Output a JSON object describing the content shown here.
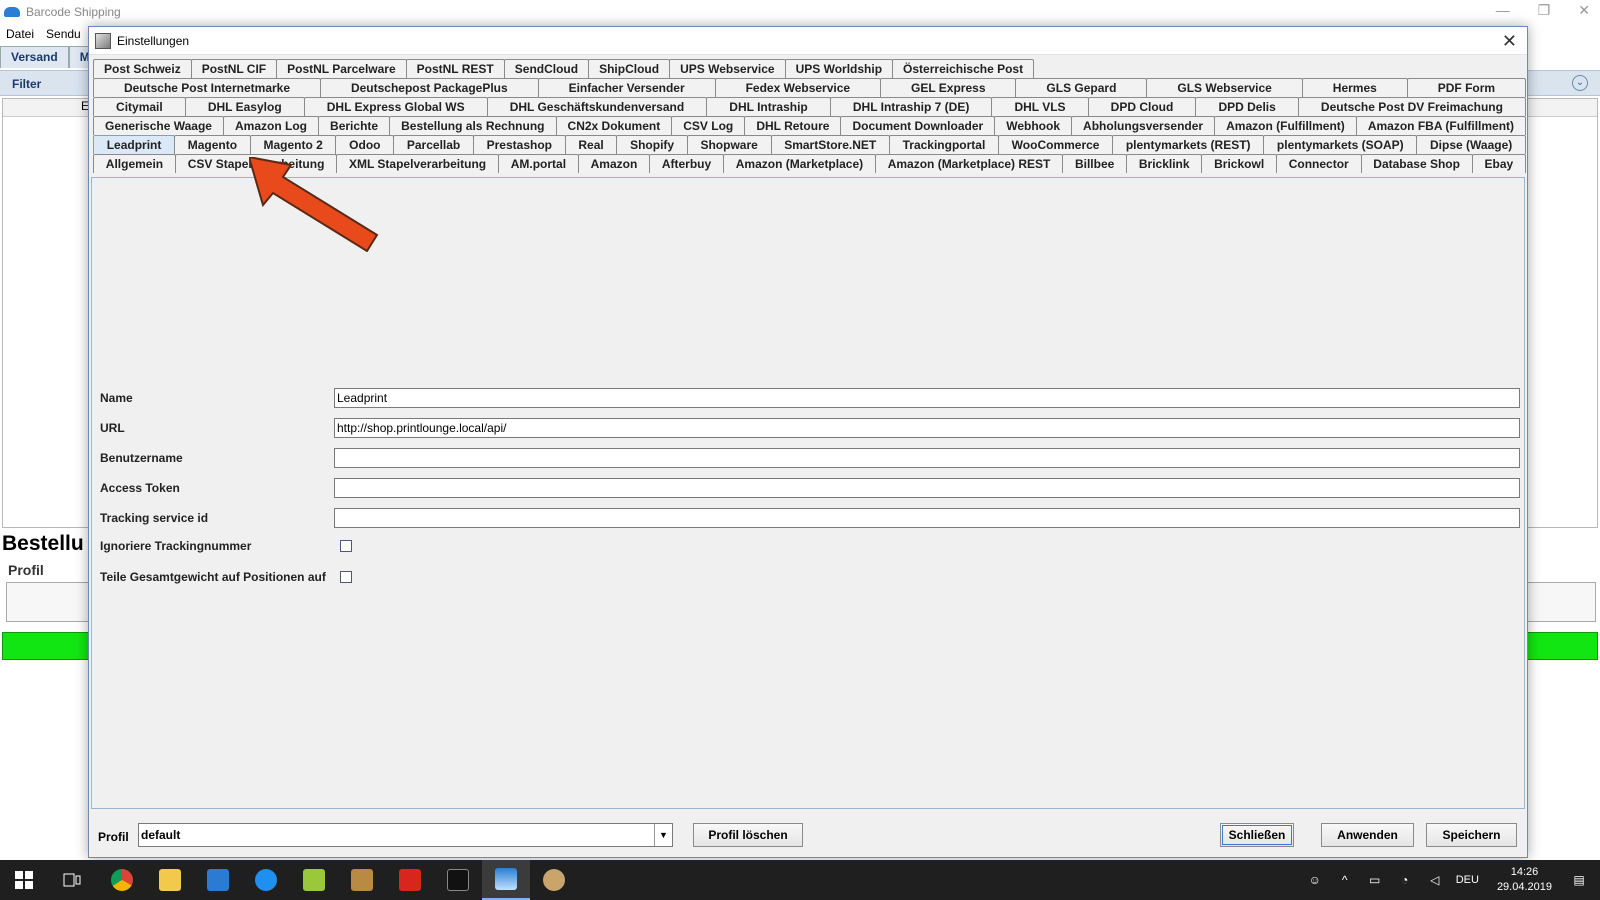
{
  "bg": {
    "window_title": "Barcode Shipping",
    "menu": [
      "Datei",
      "Sendu"
    ],
    "tabs": [
      "Versand",
      "M"
    ],
    "filter_label": "Filter",
    "grid_header_fragment": "E",
    "bestell_label": "Bestellu",
    "profil_label": "Profil"
  },
  "dialog": {
    "title": "Einstellungen",
    "tab_rows": [
      [
        "Post Schweiz",
        "PostNL CIF",
        "PostNL Parcelware",
        "PostNL REST",
        "SendCloud",
        "ShipCloud",
        "UPS Webservice",
        "UPS Worldship",
        "Österreichische Post"
      ],
      [
        "Deutsche Post Internetmarke",
        "Deutschepost PackagePlus",
        "Einfacher Versender",
        "Fedex Webservice",
        "GEL Express",
        "GLS Gepard",
        "GLS Webservice",
        "Hermes",
        "PDF Form"
      ],
      [
        "Citymail",
        "DHL Easylog",
        "DHL Express Global WS",
        "DHL Geschäftskundenversand",
        "DHL Intraship",
        "DHL Intraship 7 (DE)",
        "DHL VLS",
        "DPD Cloud",
        "DPD Delis",
        "Deutsche Post DV Freimachung"
      ],
      [
        "Generische Waage",
        "Amazon Log",
        "Berichte",
        "Bestellung als Rechnung",
        "CN2x Dokument",
        "CSV Log",
        "DHL Retoure",
        "Document Downloader",
        "Webhook",
        "Abholungsversender",
        "Amazon (Fulfillment)",
        "Amazon FBA (Fulfillment)"
      ],
      [
        "Leadprint",
        "Magento",
        "Magento 2",
        "Odoo",
        "Parcellab",
        "Prestashop",
        "Real",
        "Shopify",
        "Shopware",
        "SmartStore.NET",
        "Trackingportal",
        "WooCommerce",
        "plentymarkets (REST)",
        "plentymarkets (SOAP)",
        "Dipse (Waage)"
      ],
      [
        "Allgemein",
        "CSV Stapelverarbeitung",
        "XML Stapelverarbeitung",
        "AM.portal",
        "Amazon",
        "Afterbuy",
        "Amazon (Marketplace)",
        "Amazon (Marketplace) REST",
        "Billbee",
        "Bricklink",
        "Brickowl",
        "Connector",
        "Database Shop",
        "Ebay"
      ]
    ],
    "active_tab": "Leadprint",
    "form": {
      "name_label": "Name",
      "name_value": "Leadprint",
      "url_label": "URL",
      "url_value": "http://shop.printlounge.local/api/",
      "user_label": "Benutzername",
      "user_value": "",
      "token_label": "Access Token",
      "token_value": "",
      "tracking_label": "Tracking service id",
      "tracking_value": "",
      "ignore_label": "Ignoriere Trackingnummer",
      "ignore_checked": false,
      "split_label": "Teile Gesamtgewicht auf Positionen auf",
      "split_checked": false
    },
    "bottom": {
      "profil_label": "Profil",
      "profil_value": "default",
      "delete_label": "Profil löschen",
      "close_label": "Schließen",
      "apply_label": "Anwenden",
      "save_label": "Speichern"
    }
  },
  "taskbar": {
    "apps": [
      "windows-start",
      "task-view",
      "chrome",
      "file-explorer",
      "vscode",
      "teamviewer",
      "notepad-plus",
      "package",
      "acrobat",
      "terminal",
      "barcode-shipping",
      "paint"
    ],
    "active_app": "barcode-shipping",
    "lang": "DEU",
    "time": "14:26",
    "date": "29.04.2019",
    "notifications": "1"
  },
  "colors": {
    "arrow": "#e84a1b",
    "active_tab": "#dbe8f7",
    "status_green": "#12e612",
    "taskbar": "#1f1f1f"
  }
}
